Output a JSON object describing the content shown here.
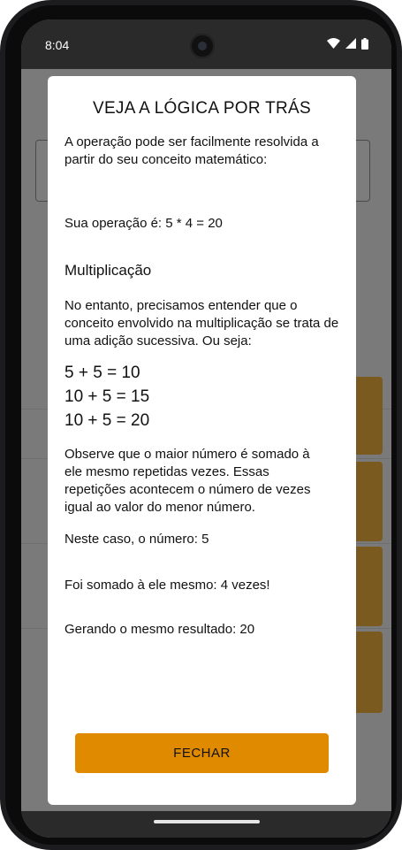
{
  "status_bar": {
    "time": "8:04",
    "icons": [
      "wifi-icon",
      "signal-icon",
      "battery-icon"
    ]
  },
  "dialog": {
    "title": "VEJA A LÓGICA POR TRÁS",
    "intro": "A operação pode ser facilmente resolvida a partir do seu conceito matemático:",
    "operation": "Sua operação é: 5 * 4 = 20",
    "section_title": "Multiplicação",
    "explanation": "No entanto, precisamos entender que o conceito envolvido na multiplicação se trata de uma adição sucessiva. Ou seja:",
    "equations": [
      "5 + 5 = 10",
      "10 + 5 = 15",
      "10 + 5 = 20"
    ],
    "observation": "Observe que o maior número é somado à ele mesmo repetidas vezes. Essas repetições acontecem o número de vezes igual ao valor do menor número.",
    "case_number": "Neste caso, o número: 5",
    "times_added": "Foi somado à ele mesmo: 4 vezes!",
    "result": "Gerando o mesmo resultado: 20",
    "close_label": "FECHAR"
  },
  "colors": {
    "accent": "#e08a00",
    "scrim": "#777777",
    "dialog_bg": "#ffffff"
  }
}
